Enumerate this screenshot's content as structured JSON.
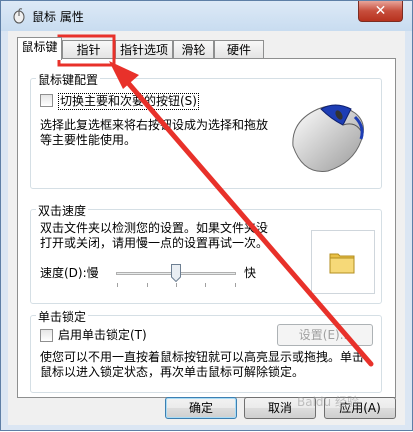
{
  "window": {
    "title": "鼠标 属性",
    "close_glyph": "✕"
  },
  "tabs": [
    {
      "label": "鼠标键",
      "active": true
    },
    {
      "label": "指针",
      "active": false,
      "highlighted": true
    },
    {
      "label": "指针选项",
      "active": false
    },
    {
      "label": "滑轮",
      "active": false
    },
    {
      "label": "硬件",
      "active": false
    }
  ],
  "button_config": {
    "title": "鼠标键配置",
    "swap_checkbox_label": "切换主要和次要的按钮(S)",
    "swap_checked": false,
    "description_line1": "选择此复选框来将右按钮设成为选择和拖放",
    "description_line2": "等主要性能使用。"
  },
  "double_click": {
    "title": "双击速度",
    "description_line1": "双击文件夹以检测您的设置。如果文件夹没",
    "description_line2": "打开或关闭，请用慢一点的设置再试一次。",
    "speed_label": "速度(D):慢",
    "fast_label": "快",
    "speed_value": 0.5
  },
  "click_lock": {
    "title": "单击锁定",
    "checkbox_label": "启用单击锁定(T)",
    "checked": false,
    "settings_button": "设置(E)...",
    "description_line1": "使您可以不用一直按着鼠标按钮就可以高亮显示或拖拽。单击",
    "description_line2": "鼠标以进入锁定状态，再次单击鼠标可解除锁定。"
  },
  "footer": {
    "ok": "确定",
    "cancel": "取消",
    "apply": "应用(A)"
  },
  "watermark": "Baidu 经验",
  "colors": {
    "annotation_red": "#e8312a",
    "title_bar": "#c8dcf0",
    "folder": "#f2d266"
  }
}
